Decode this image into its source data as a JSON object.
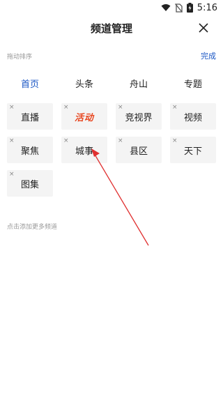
{
  "status_bar": {
    "time": "5:16",
    "icons": [
      "wifi-icon",
      "no-sim-icon",
      "battery-charging-icon"
    ]
  },
  "header": {
    "title": "频道管理",
    "close_icon": "close-icon"
  },
  "my_channels": {
    "hint": "拖动排序",
    "done_label": "完成",
    "pinned": [
      {
        "label": "首页",
        "active": true
      },
      {
        "label": "头条"
      },
      {
        "label": "舟山"
      },
      {
        "label": "专题"
      }
    ],
    "removable": [
      {
        "label": "直播"
      },
      {
        "label": "活动",
        "style": "promo-logo"
      },
      {
        "label": "竞视界"
      },
      {
        "label": "视频"
      },
      {
        "label": "聚焦"
      },
      {
        "label": "城事"
      },
      {
        "label": "县区"
      },
      {
        "label": "天下"
      },
      {
        "label": "图集"
      }
    ],
    "delete_glyph": "×"
  },
  "more_channels": {
    "hint": "点击添加更多频道"
  },
  "annotation": {
    "type": "arrow",
    "color": "#e03030"
  },
  "colors": {
    "accent": "#1a56c4",
    "chip_bg": "#f4f4f4",
    "promo": "#e8461f"
  }
}
